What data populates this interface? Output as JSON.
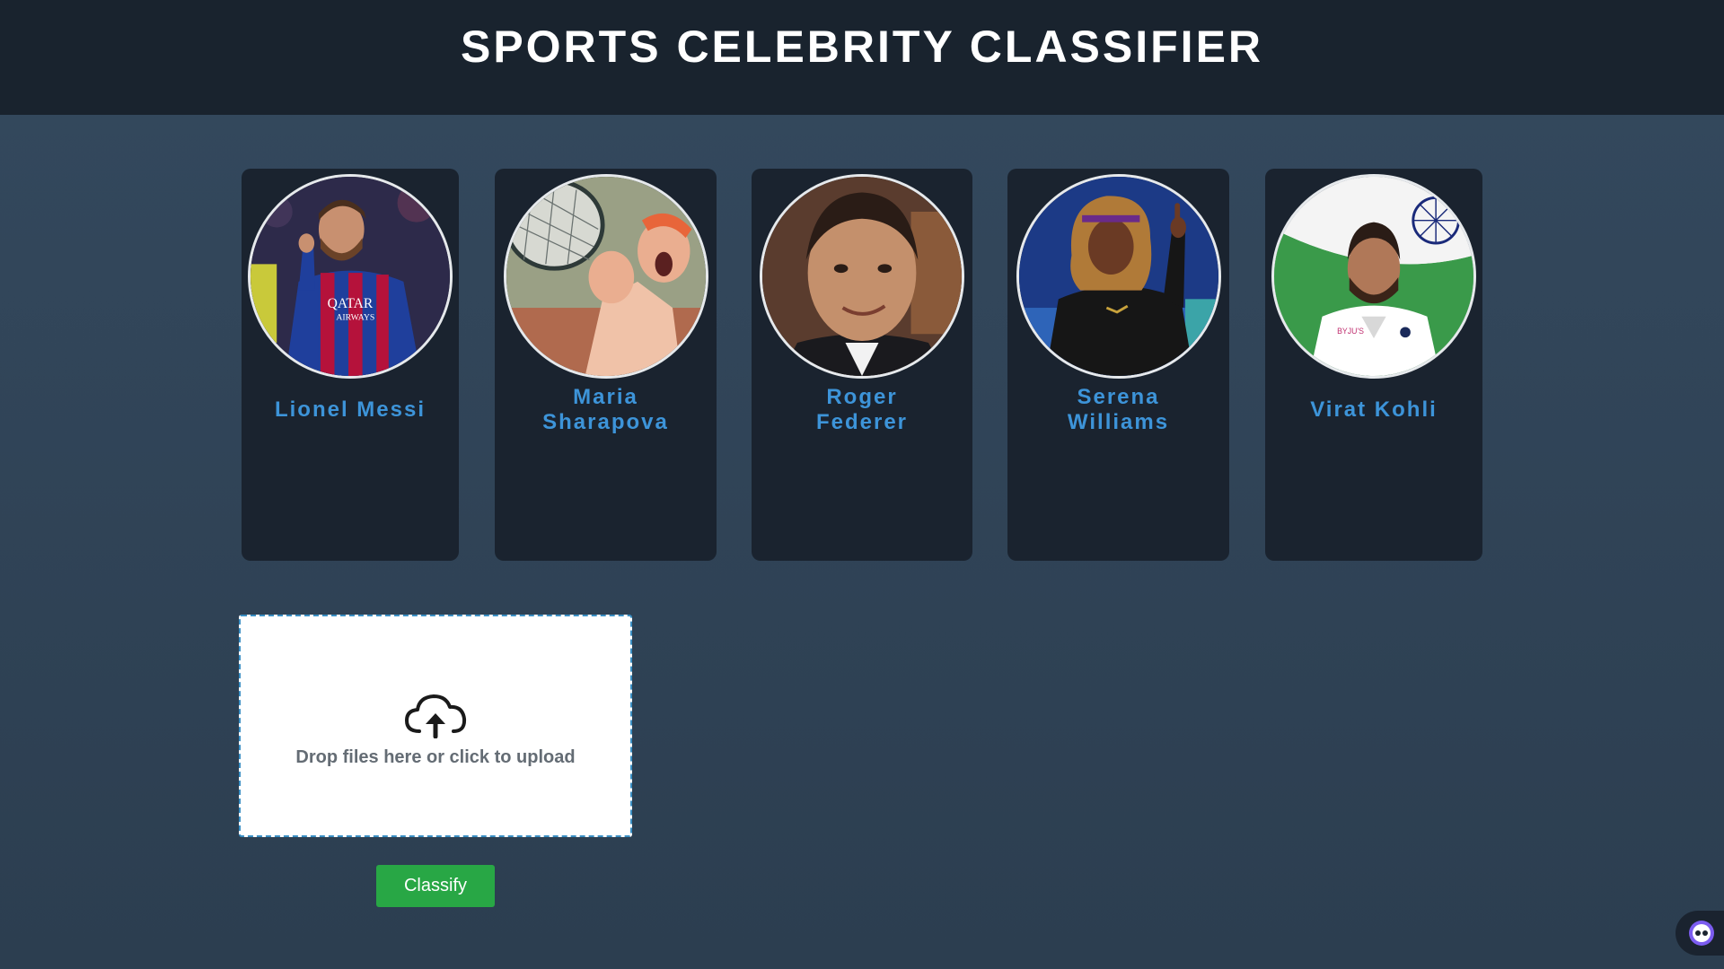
{
  "header": {
    "title": "SPORTS CELEBRITY CLASSIFIER"
  },
  "celebrities": [
    {
      "name": "Lionel Messi",
      "photo": "messi-photo"
    },
    {
      "name": "Maria Sharapova",
      "photo": "sharapova-photo"
    },
    {
      "name": "Roger Federer",
      "photo": "federer-photo"
    },
    {
      "name": "Serena Williams",
      "photo": "serena-photo"
    },
    {
      "name": "Virat Kohli",
      "photo": "kohli-photo"
    }
  ],
  "upload": {
    "text": "Drop files here or click to upload",
    "icon": "cloud-upload-icon"
  },
  "actions": {
    "classify_label": "Classify"
  },
  "chat_widget": {
    "icon": "chat-bot-icon"
  },
  "colors": {
    "header_bg": "#19232e",
    "page_bg": "#2c3e50",
    "card_bg": "#1a232f",
    "name_color": "#3d94d9",
    "button_bg": "#28a745"
  }
}
